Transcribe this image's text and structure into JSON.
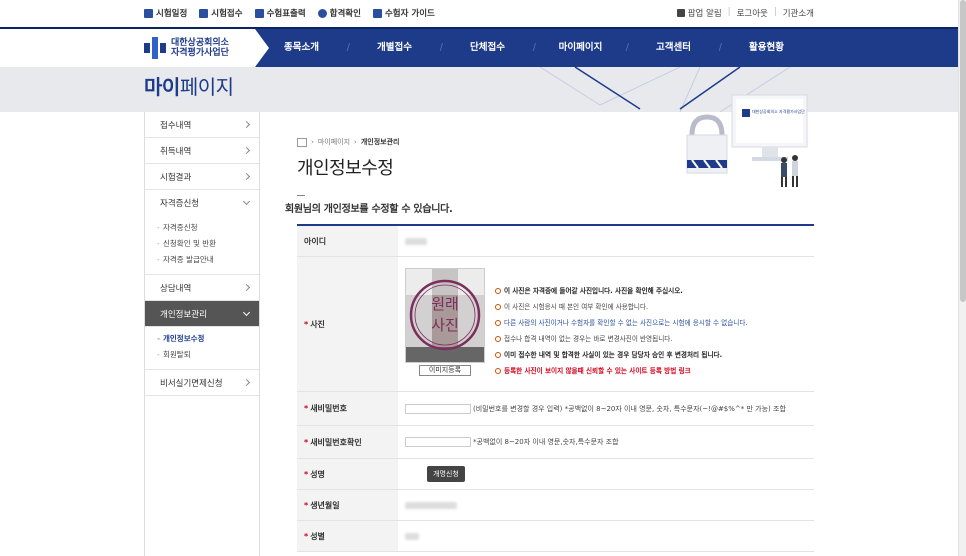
{
  "topbar": {
    "links": [
      {
        "label": "시험일정",
        "icon": "calendar-icon"
      },
      {
        "label": "시험접수",
        "icon": "register-icon"
      },
      {
        "label": "수험표출력",
        "icon": "print-icon"
      },
      {
        "label": "합격확인",
        "icon": "person-icon"
      },
      {
        "label": "수험자 가이드",
        "icon": "guide-icon"
      }
    ],
    "popup": "팝업 알림",
    "logout": "로그아웃",
    "intro": "기관소개"
  },
  "logo": {
    "line1": "대한상공회의소",
    "line2": "자격평가사업단"
  },
  "gnb": [
    "종목소개",
    "개별접수",
    "단체접수",
    "마이페이지",
    "고객센터",
    "활용현황"
  ],
  "band": {
    "title_bold": "마이",
    "title_rest": "페이지"
  },
  "lnb": {
    "items": [
      {
        "label": "접수내역"
      },
      {
        "label": "취득내역"
      },
      {
        "label": "시험결과"
      },
      {
        "label": "자격증신청"
      }
    ],
    "sub1": [
      "자격증신청",
      "신청확인 및 반환",
      "자격증 발급안내"
    ],
    "item5": "상담내역",
    "active": "개인정보관리",
    "sub2": [
      "개인정보수정",
      "회원탈퇴"
    ],
    "item7": "비서실기면제신청"
  },
  "breadcrumb": {
    "b1": "마이페이지",
    "b2": "개인정보관리"
  },
  "page_title": "개인정보수정",
  "desc": "회원님의 개인정보를 수정할 수 있습니다.",
  "illus_logo": "대한상공회의소 자격평가사업단",
  "form": {
    "id_label": "아이디",
    "photo_label": "사진",
    "photo_stamp": [
      "원래",
      "사진"
    ],
    "photo_btn": "이미지등록",
    "notes": [
      "이 사진은 자격증에 들어갈 사진입니다. 사진을 확인해 주십시오.",
      "이 사진은 시험응시 때 본인 여부 확인에 사용합니다.",
      "다른 사람의 사진이거나 수험자를 확인할 수 없는 사진으로는 시험에 응시할 수 없습니다.",
      "접수나 합격 내역이 없는 경우는 바로 변경사진이 반영됩니다.",
      "이미 접수한 내역 및 합격한 사실이 있는 경우 담당자 승인 후 변경처리 됩니다.",
      "등록한 사진이 보이지 않을때 신뢰할 수 있는 사이트 등록 방법 링크"
    ],
    "pw_label": "새비밀번호",
    "pw_help": "(비밀번호를 변경할 경우 입력) *공백없이 8~20자 이내 영문, 숫자, 특수문자(~!@#$%^* 만 가능) 조합",
    "pw2_label": "새비밀번호확인",
    "pw2_help": "*공백없이 8~20자 이내 영문,숫자,특수문자 조합",
    "name_label": "성명",
    "name_btn": "개명신청",
    "birth_label": "생년월일",
    "gender_label": "성별"
  },
  "colors": {
    "brand": "#1e3b8a",
    "required": "#d0021b"
  }
}
